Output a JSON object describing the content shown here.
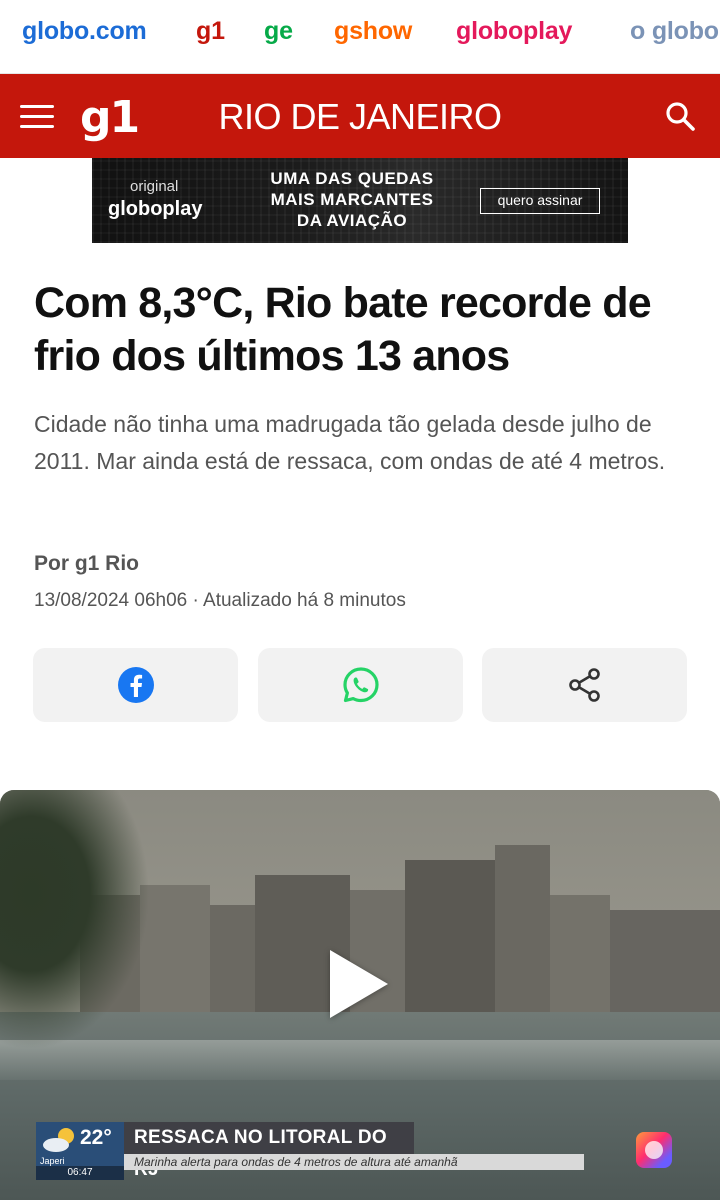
{
  "globo_nav": [
    {
      "label": "globo.com",
      "color": "#1c6cd6"
    },
    {
      "label": "g1",
      "color": "#c4170c"
    },
    {
      "label": "ge",
      "color": "#06aa48"
    },
    {
      "label": "gshow",
      "color": "#ff6700"
    },
    {
      "label": "globoplay",
      "color": "#e4195b"
    },
    {
      "label": "o globo",
      "color": "#7b93b6"
    }
  ],
  "header": {
    "logo": "g1",
    "region": "RIO DE JANEIRO",
    "bg_color": "#c4170c"
  },
  "ad": {
    "original_label": "original",
    "brand": "globoplay",
    "headline_line1": "UMA DAS QUEDAS",
    "headline_line2": "MAIS MARCANTES",
    "headline_line3": "DA AVIAÇÃO",
    "cta": "quero assinar"
  },
  "article": {
    "headline": "Com 8,3°C, Rio bate recorde de frio dos últimos 13 anos",
    "subtitle": "Cidade não tinha uma madrugada tão gelada desde julho de 2011. Mar ainda está de ressaca, com ondas de até 4 metros.",
    "byline": "Por g1 Rio",
    "dateline": "13/08/2024 06h06 · Atualizado há 8 minutos"
  },
  "share": {
    "facebook": "facebook-icon",
    "whatsapp": "whatsapp-icon",
    "share": "share-icon"
  },
  "video": {
    "weather_temp": "22°",
    "weather_label": "Japeri",
    "weather_time": "06:47",
    "ticker_title": "RESSACA NO LITORAL DO RJ",
    "ticker_sub": "Marinha alerta para ondas de 4 metros de altura até amanhã"
  }
}
